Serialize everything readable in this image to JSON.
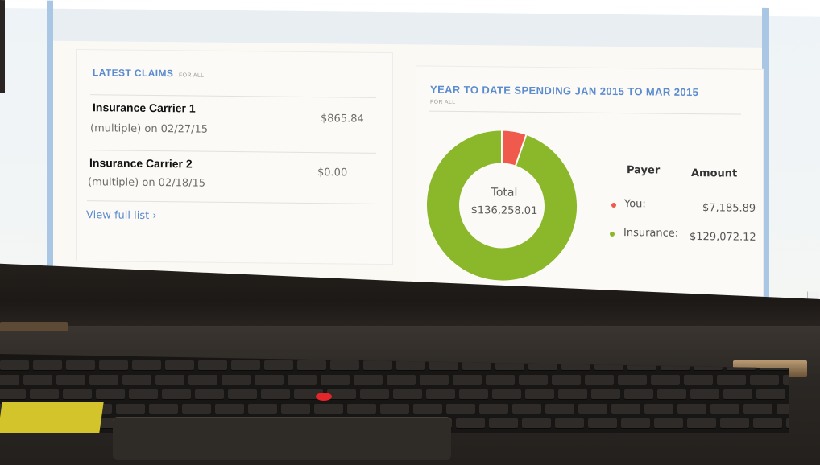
{
  "claims": {
    "title": "LATEST CLAIMS",
    "subtitle": "FOR ALL",
    "items": [
      {
        "carrier": "Insurance Carrier 1",
        "detail": "(multiple) on 02/27/15",
        "amount": "$865.84"
      },
      {
        "carrier": "Insurance Carrier 2",
        "detail": "(multiple) on 02/18/15",
        "amount": "$0.00"
      }
    ],
    "view_full": "View full list ›"
  },
  "spending": {
    "title": "YEAR TO DATE SPENDING JAN 2015 TO MAR 2015",
    "subtitle": "FOR ALL",
    "total_label": "Total",
    "total_value": "$136,258.01",
    "legend_payer": "Payer",
    "legend_amount": "Amount",
    "rows": [
      {
        "payer": "You:",
        "amount": "$7,185.89",
        "color": "#ef5a4c"
      },
      {
        "payer": "Insurance:",
        "amount": "$129,072.12",
        "color": "#8bb82a"
      }
    ]
  },
  "chart_data": {
    "type": "pie",
    "categories": [
      "You",
      "Insurance"
    ],
    "values": [
      7185.89,
      129072.12
    ],
    "colors": [
      "#ef5a4c",
      "#8bb82a"
    ],
    "title": "YEAR TO DATE SPENDING JAN 2015 TO MAR 2015"
  },
  "laptop": {
    "trackpoint_color": "#e3262a"
  }
}
